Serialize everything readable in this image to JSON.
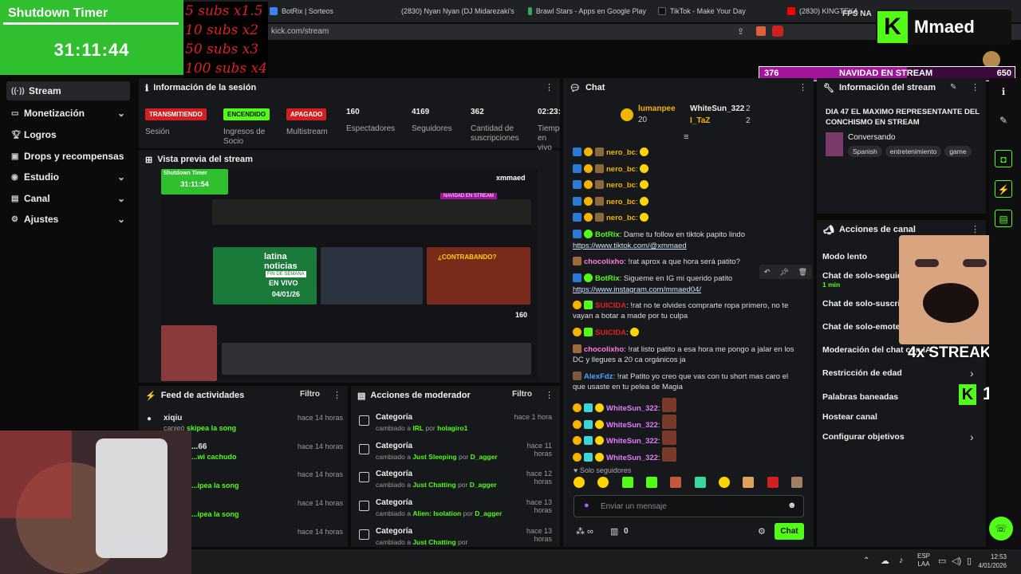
{
  "browser": {
    "tabs": [
      {
        "label": "BotRix | Sorteos",
        "color": "#3b82f6"
      },
      {
        "label": "(2830) Nyan Nyan (DJ Midarezaki's r...",
        "color": "#ff0000"
      },
      {
        "label": "Brawl Stars - Apps en Google Play",
        "color": "#34a853"
      },
      {
        "label": "TikTok - Make Your Day",
        "color": "#111111"
      },
      {
        "label": "(2830) KINGTEKA",
        "color": "#ff0000"
      }
    ],
    "url": "kick.com/stream",
    "right_text": "FPS NA"
  },
  "overlay": {
    "timer_title": "Shutdown Timer",
    "timer_value": "31:11:44",
    "subs_goals": [
      "5 subs x1.5",
      "10 subs x2",
      "50 subs x3",
      "100 subs x4"
    ],
    "brand": "Mmaed",
    "goal_bar": {
      "left": "376",
      "title": "NAVIDAD EN STREAM",
      "right": "650",
      "progress_fraction": 0.578
    },
    "streak": "4x STREAK",
    "viewers": "160"
  },
  "sidebar": {
    "items": [
      {
        "label": "Stream",
        "icon": "broadcast-icon",
        "active": true,
        "has_chevron": false
      },
      {
        "label": "Monetización",
        "icon": "money-icon",
        "active": false,
        "has_chevron": true
      },
      {
        "label": "Logros",
        "icon": "trophy-icon",
        "active": false,
        "has_chevron": false
      },
      {
        "label": "Drops y recompensas",
        "icon": "gift-icon",
        "active": false,
        "has_chevron": false
      },
      {
        "label": "Estudio",
        "icon": "studio-icon",
        "active": false,
        "has_chevron": true
      },
      {
        "label": "Canal",
        "icon": "channel-icon",
        "active": false,
        "has_chevron": true
      },
      {
        "label": "Ajustes",
        "icon": "settings-icon",
        "active": false,
        "has_chevron": true
      }
    ]
  },
  "session": {
    "title": "Información de la sesión",
    "buttons": {
      "live": "TRANSMITIENDO",
      "on": "ENCENDIDO",
      "off": "APAGADO"
    },
    "labels": {
      "session": "Sesión",
      "partner": "Ingresos de Socio",
      "multistream": "Multistream"
    },
    "stats": [
      {
        "value": "160",
        "label": "Espectadores"
      },
      {
        "value": "4169",
        "label": "Seguidores"
      },
      {
        "value": "362",
        "label": "Cantidad de suscripciones"
      },
      {
        "value": "02:23:",
        "label": "Tiempo en vivo"
      }
    ]
  },
  "preview": {
    "title": "Vista previa del stream",
    "timer_title": "Shutdown Timer",
    "timer_value": "31:11:54",
    "thumb_title": "latina noticias",
    "thumb_sub": "FIN DE SEMANA",
    "thumb_live": "EN VIVO",
    "thumb_date": "04/01/26",
    "thumb_contra": "¿CONTRABANDO?",
    "viewer_count": "160",
    "brand": "xmmaed",
    "goal": "NAVIDAD EN STREAM"
  },
  "chat": {
    "title": "Chat",
    "pinned": {
      "user1": "lumanpee",
      "count1": "20",
      "user2": "WhiteSun_322",
      "count2": "2",
      "user3": "I_TaZ",
      "count3": "2"
    },
    "messages": [
      {
        "user": "nero_bc",
        "text": "",
        "color": "#f5b400"
      },
      {
        "user": "nero_bc",
        "text": "",
        "color": "#f5b400"
      },
      {
        "user": "nero_bc",
        "text": "",
        "color": "#f5b400"
      },
      {
        "user": "nero_bc",
        "text": "",
        "color": "#f5b400"
      },
      {
        "user": "nero_bc",
        "text": "",
        "color": "#f5b400"
      }
    ],
    "botrix1_user": "BotRix",
    "botrix1_text": "Dame tu follow en tiktok papito lindo",
    "botrix1_link": "https://www.tiktok.com/@xmmaed",
    "choco1_user": "chocolixho",
    "choco1_text": "!rat aprox a que hora será patito?",
    "botrix2_user": "BotRix",
    "botrix2_text": "Sigueme en IG mi querido patito",
    "botrix2_link": "https://www.instagram.com/mmaed04/",
    "suicida1_user": "SUICIDA",
    "suicida1_text": "!rat no te olvides comprarte ropa primero, no te vayan a botar a made por tu culpa",
    "suicida2_user": "SUICIDA",
    "choco2_user": "chocolixho",
    "choco2_text": "!rat listo patito a esa hora me pongo a jalar en los DC y llegues a 20 ca orgánicos ja",
    "alex_user": "AlexFdz",
    "alex_text": "!rat Patito yo creo que vas con tu short mas caro el que usaste en tu pelea de Magia",
    "white_user": "WhiteSun_322",
    "followers_only": "Solo seguidores",
    "input_placeholder": "Enviar un mensaje",
    "points": "0",
    "send": "Chat"
  },
  "activity": {
    "title": "Feed de actividades",
    "filter": "Filtro",
    "items": [
      {
        "user": "xiqiu",
        "action": "canjeó",
        "reward": "skipea la song",
        "time": "hace 14 horas"
      },
      {
        "user": "...66",
        "action": "",
        "reward": "...wi cachudo",
        "time": "hace 14 horas"
      },
      {
        "user": "",
        "action": "",
        "reward": "...ipea la song",
        "time": "hace 14 horas"
      },
      {
        "user": "",
        "action": "",
        "reward": "...ipea la song",
        "time": "hace 14 horas"
      },
      {
        "user": "",
        "action": "",
        "reward": "",
        "time": "hace 14 horas"
      }
    ]
  },
  "moderator": {
    "title": "Acciones de moderador",
    "filter": "Filtro",
    "items": [
      {
        "title": "Categoría",
        "prefix": "cambiado a",
        "target": "IRL",
        "by": "por",
        "mod": "holagiro1",
        "time": "hace 1 hora"
      },
      {
        "title": "Categoría",
        "prefix": "cambiado a",
        "target": "Just Sleeping",
        "by": "por",
        "mod": "D_agger",
        "time": "hace 11 horas"
      },
      {
        "title": "Categoría",
        "prefix": "cambiado a",
        "target": "Just Chatting",
        "by": "por",
        "mod": "D_agger",
        "time": "hace 12 horas"
      },
      {
        "title": "Categoría",
        "prefix": "cambiado a",
        "target": "Alien: Isolation",
        "by": "por",
        "mod": "D_agger",
        "time": "hace 13 horas"
      },
      {
        "title": "Categoría",
        "prefix": "cambiado a",
        "target": "Just Chatting",
        "by": "por",
        "mod": "",
        "time": "hace 13 horas"
      }
    ]
  },
  "stream_info": {
    "title": "Información del stream",
    "stream_title": "DIA 47 EL MAXIMO REPRESENTANTE DEL CONCHISMO EN STREAM",
    "category": "Conversando",
    "tags": [
      "Spanish",
      "entretenimiento",
      "game"
    ]
  },
  "channel_actions": {
    "title": "Acciones de canal",
    "rows": [
      {
        "label": "Modo lento",
        "sub": "",
        "chevron": false
      },
      {
        "label": "Chat de solo-seguidores",
        "sub": "1 min",
        "chevron": false
      },
      {
        "label": "Chat de solo-suscriptores",
        "sub": "",
        "chevron": false
      },
      {
        "label": "Chat de solo-emotes",
        "sub": "",
        "chevron": false
      },
      {
        "label": "Moderación del chat con IA",
        "sub": "",
        "chevron": false
      },
      {
        "label": "Restricción de edad",
        "sub": "",
        "chevron": true
      },
      {
        "label": "Palabras baneadas",
        "sub": "",
        "chevron": false
      },
      {
        "label": "Hostear canal",
        "sub": "",
        "chevron": false
      },
      {
        "label": "Configurar objetivos",
        "sub": "",
        "chevron": true
      }
    ]
  },
  "taskbar": {
    "lang1": "ESP",
    "lang2": "LAA",
    "time": "12:53",
    "date": "4/01/2026"
  },
  "colors": {
    "kick_green": "#53fc18",
    "live_red": "#d31f1f",
    "panel": "#17181b"
  }
}
